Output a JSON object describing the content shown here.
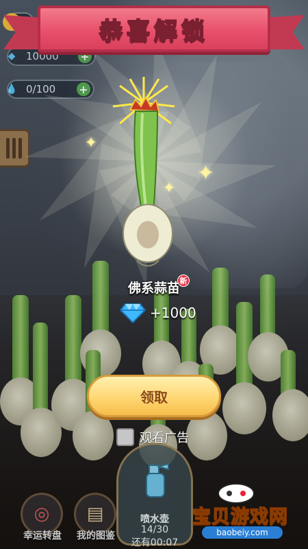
{
  "popup": {
    "title": "恭喜解锁",
    "plant_name": "佛系蒜苗",
    "new_badge": "新",
    "reward_amount": "+1000",
    "claim_label": "领取",
    "watch_ad_label": "观看广告",
    "watch_ad_checked": false
  },
  "hud": {
    "diamonds": "10000",
    "water": "0/100"
  },
  "bottom_nav": {
    "lucky_wheel": "幸运转盘",
    "my_album": "我的图鉴",
    "watering_can": "喷水壶",
    "water_count": "14/30",
    "timer": "还有00:07"
  },
  "watermark": {
    "title": "宝贝游戏网",
    "url": "baobeiy.com"
  },
  "colors": {
    "banner": "#e9506b",
    "claim_button": "#ffd773",
    "diamond": "#3fb8ff"
  },
  "icons": [
    "coin-icon",
    "diamond-icon",
    "water-drop-icon",
    "menu-icon",
    "sparkle-icon",
    "crown-icon",
    "spray-bottle-icon",
    "wheel-icon",
    "book-icon"
  ]
}
